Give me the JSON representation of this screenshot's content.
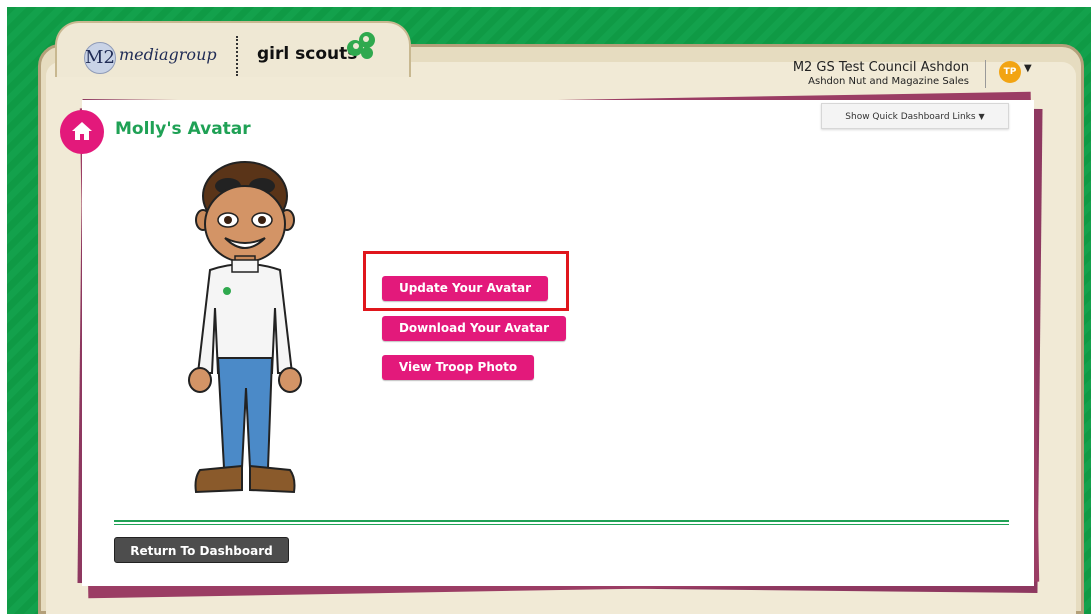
{
  "header": {
    "logo": {
      "m2_text": "M2",
      "mediagroup_text": "mediagroup",
      "girlscouts_text": "girl scouts"
    },
    "council_name": "M2 GS Test Council Ashdon",
    "sale_name": "Ashdon Nut and Magazine Sales",
    "user_initials": "TP"
  },
  "page": {
    "title": "Molly's Avatar",
    "quick_links_label": "Show Quick Dashboard Links"
  },
  "actions": {
    "update_avatar": "Update Your Avatar",
    "download_avatar": "Download Your Avatar",
    "view_troop_photo": "View Troop Photo",
    "return_dashboard": "Return To Dashboard"
  },
  "colors": {
    "accent_pink": "#e3197b",
    "accent_green": "#1fa155",
    "highlight_red": "#e0161c",
    "badge_orange": "#f2a413"
  },
  "icons": {
    "home": "home-icon",
    "caret": "caret-down-icon",
    "trefoil": "girl-scouts-trefoil-icon"
  }
}
